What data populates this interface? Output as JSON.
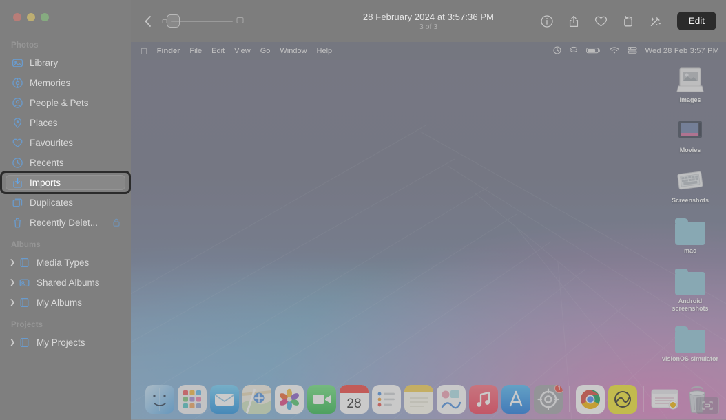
{
  "window": {
    "traffic_lights": [
      "close",
      "minimize",
      "zoom"
    ]
  },
  "sidebar": {
    "sections": [
      {
        "title": "Photos",
        "items": [
          {
            "label": "Library",
            "icon": "photos-library-icon",
            "selected": false,
            "expandable": false,
            "locked": false
          },
          {
            "label": "Memories",
            "icon": "memories-icon",
            "selected": false,
            "expandable": false,
            "locked": false
          },
          {
            "label": "People & Pets",
            "icon": "people-pets-icon",
            "selected": false,
            "expandable": false,
            "locked": false
          },
          {
            "label": "Places",
            "icon": "places-pin-icon",
            "selected": false,
            "expandable": false,
            "locked": false
          },
          {
            "label": "Favourites",
            "icon": "heart-icon",
            "selected": false,
            "expandable": false,
            "locked": false
          },
          {
            "label": "Recents",
            "icon": "recents-clock-icon",
            "selected": false,
            "expandable": false,
            "locked": false
          },
          {
            "label": "Imports",
            "icon": "imports-icon",
            "selected": true,
            "expandable": false,
            "locked": false
          },
          {
            "label": "Duplicates",
            "icon": "duplicates-icon",
            "selected": false,
            "expandable": false,
            "locked": false
          },
          {
            "label": "Recently Delet...",
            "icon": "trash-icon",
            "selected": false,
            "expandable": false,
            "locked": true
          }
        ]
      },
      {
        "title": "Albums",
        "items": [
          {
            "label": "Media Types",
            "icon": "album-folder-icon",
            "selected": false,
            "expandable": true,
            "locked": false
          },
          {
            "label": "Shared Albums",
            "icon": "shared-album-icon",
            "selected": false,
            "expandable": true,
            "locked": false
          },
          {
            "label": "My Albums",
            "icon": "album-folder-icon",
            "selected": false,
            "expandable": true,
            "locked": false
          }
        ]
      },
      {
        "title": "Projects",
        "items": [
          {
            "label": "My Projects",
            "icon": "album-folder-icon",
            "selected": false,
            "expandable": true,
            "locked": false
          }
        ]
      }
    ]
  },
  "toolbar": {
    "back_icon": "chevron-left-icon",
    "zoom_small_icon": "small-photo-icon",
    "zoom_large_icon": "large-photo-icon",
    "title": "28 February 2024 at 3:57:36 PM",
    "subtitle": "3 of 3",
    "actions": [
      {
        "name": "info-icon",
        "label": "Info"
      },
      {
        "name": "share-icon",
        "label": "Share"
      },
      {
        "name": "favourite-heart-icon",
        "label": "Favourite"
      },
      {
        "name": "rotate-icon",
        "label": "Rotate"
      },
      {
        "name": "auto-enhance-icon",
        "label": "Auto Enhance"
      }
    ],
    "edit_label": "Edit"
  },
  "photo": {
    "menu_bar": {
      "apple_logo": "apple-logo-icon",
      "items": [
        "Finder",
        "File",
        "Edit",
        "View",
        "Go",
        "Window",
        "Help"
      ],
      "status_icons": [
        "siri-icon",
        "dropbox-icon",
        "battery-icon",
        "wifi-icon",
        "control-centre-icon"
      ],
      "clock": "Wed 28 Feb  3:57 PM"
    },
    "desktop_icons": [
      {
        "label": "Images",
        "icon": "images-folder-icon"
      },
      {
        "label": "Movies",
        "icon": "movies-folder-icon"
      },
      {
        "label": "Screenshots",
        "icon": "screenshots-folder-icon"
      },
      {
        "label": "mac",
        "icon": "blue-folder-icon"
      },
      {
        "label": "Android screenshots",
        "icon": "blue-folder-icon"
      },
      {
        "label": "visionOS simulator",
        "icon": "blue-folder-icon"
      }
    ],
    "dock": [
      {
        "name": "finder",
        "label": "Finder",
        "color": "#8fc6ea",
        "glyph": "🙂",
        "running": true,
        "badge": null
      },
      {
        "name": "launchpad",
        "label": "Launchpad",
        "color": "#f0f0f2",
        "glyph": "",
        "running": false,
        "badge": null
      },
      {
        "name": "mail",
        "label": "Mail",
        "color": "#4fb7f0",
        "glyph": "✉",
        "running": false,
        "badge": null
      },
      {
        "name": "maps",
        "label": "Maps",
        "color": "#f2f0e8",
        "glyph": "",
        "running": false,
        "badge": null
      },
      {
        "name": "photos",
        "label": "Photos",
        "color": "#fbfbfb",
        "glyph": "",
        "running": true,
        "badge": null
      },
      {
        "name": "facetime",
        "label": "FaceTime",
        "color": "#4cd964",
        "glyph": "📹",
        "running": false,
        "badge": null
      },
      {
        "name": "calendar",
        "label": "Calendar",
        "color": "#ffffff",
        "glyph": "28",
        "running": false,
        "badge": null
      },
      {
        "name": "reminders",
        "label": "Reminders",
        "color": "#fdfdfd",
        "glyph": "",
        "running": false,
        "badge": null
      },
      {
        "name": "notes",
        "label": "Notes",
        "color": "#fdfbf0",
        "glyph": "",
        "running": false,
        "badge": null
      },
      {
        "name": "freeform",
        "label": "Freeform",
        "color": "#fdfdfd",
        "glyph": "",
        "running": false,
        "badge": null
      },
      {
        "name": "music",
        "label": "Music",
        "color": "#f8556d",
        "glyph": "♫",
        "running": false,
        "badge": null
      },
      {
        "name": "app-store",
        "label": "App Store",
        "color": "#2b9df4",
        "glyph": "A",
        "running": false,
        "badge": null
      },
      {
        "name": "system-settings",
        "label": "System Settings",
        "color": "#9a9a9f",
        "glyph": "⚙",
        "running": false,
        "badge": "1"
      },
      {
        "name": "separator-1",
        "label": "",
        "color": "",
        "glyph": "",
        "running": false,
        "badge": null
      },
      {
        "name": "chrome",
        "label": "Google Chrome",
        "color": "#ffffff",
        "glyph": "",
        "running": true,
        "badge": null
      },
      {
        "name": "freeform-yellow",
        "label": "Bear",
        "color": "#f2e52a",
        "glyph": "",
        "running": true,
        "badge": null
      },
      {
        "name": "separator-2",
        "label": "",
        "color": "",
        "glyph": "",
        "running": false,
        "badge": null
      },
      {
        "name": "downloads-stack",
        "label": "Downloads",
        "color": "#f3f3f6",
        "glyph": "",
        "running": false,
        "badge": null
      },
      {
        "name": "trash",
        "label": "Trash",
        "color": "#c9ccd2",
        "glyph": "",
        "running": false,
        "badge": null
      }
    ],
    "floating_thumbnail": "screenshot-thumbnail"
  },
  "colors": {
    "sidebar_bg": "#7f7f7f",
    "toolbar_bg": "#7d7d7d",
    "accent_blue": "#2f7fe0",
    "edit_button_bg": "#2b2b2b",
    "focus_ring": "#2b2b2b",
    "text_primary": "#e6e6e6",
    "text_secondary": "#b0b0b0"
  }
}
